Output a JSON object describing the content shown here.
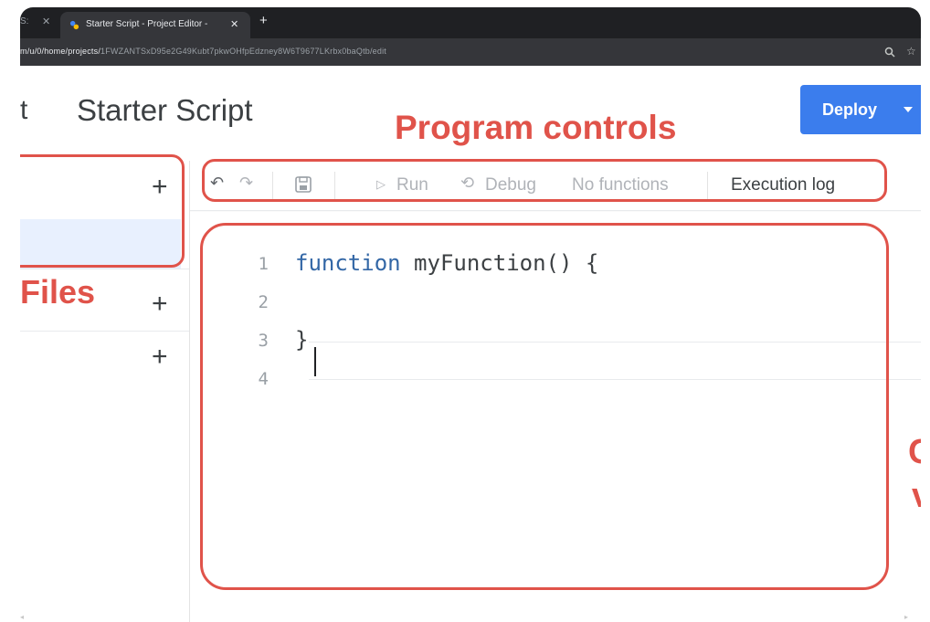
{
  "browser": {
    "prev_tab_title": "S: ",
    "active_tab_title": "Starter Script - Project Editor -",
    "url_host": "m/u/0/home/projects/",
    "url_rest": "1FWZANTSxD95e2G49Kubt7pkwOHfpEdzney8W6T9677LKrbx0baQtb/edit"
  },
  "header": {
    "app_name_tail": "t",
    "project_title": "Starter Script",
    "deploy_label": "Deploy"
  },
  "toolbar": {
    "run_label": "Run",
    "debug_label": "Debug",
    "function_select": "No functions",
    "execution_log_label": "Execution log"
  },
  "editor": {
    "line_numbers": [
      "1",
      "2",
      "3",
      "4"
    ],
    "code_lines": [
      {
        "keyword": "function",
        "text": " myFunction() {"
      },
      {
        "keyword": "",
        "text": ""
      },
      {
        "keyword": "",
        "text": "}"
      },
      {
        "keyword": "",
        "text": ""
      }
    ]
  },
  "annotations": {
    "program_controls": "Program controls",
    "files": "Files",
    "cut_line_1": "C",
    "cut_line_2": "v"
  },
  "colors": {
    "annotation": "#e0534a",
    "deploy": "#3b7ded",
    "keyword": "#3367a6"
  }
}
